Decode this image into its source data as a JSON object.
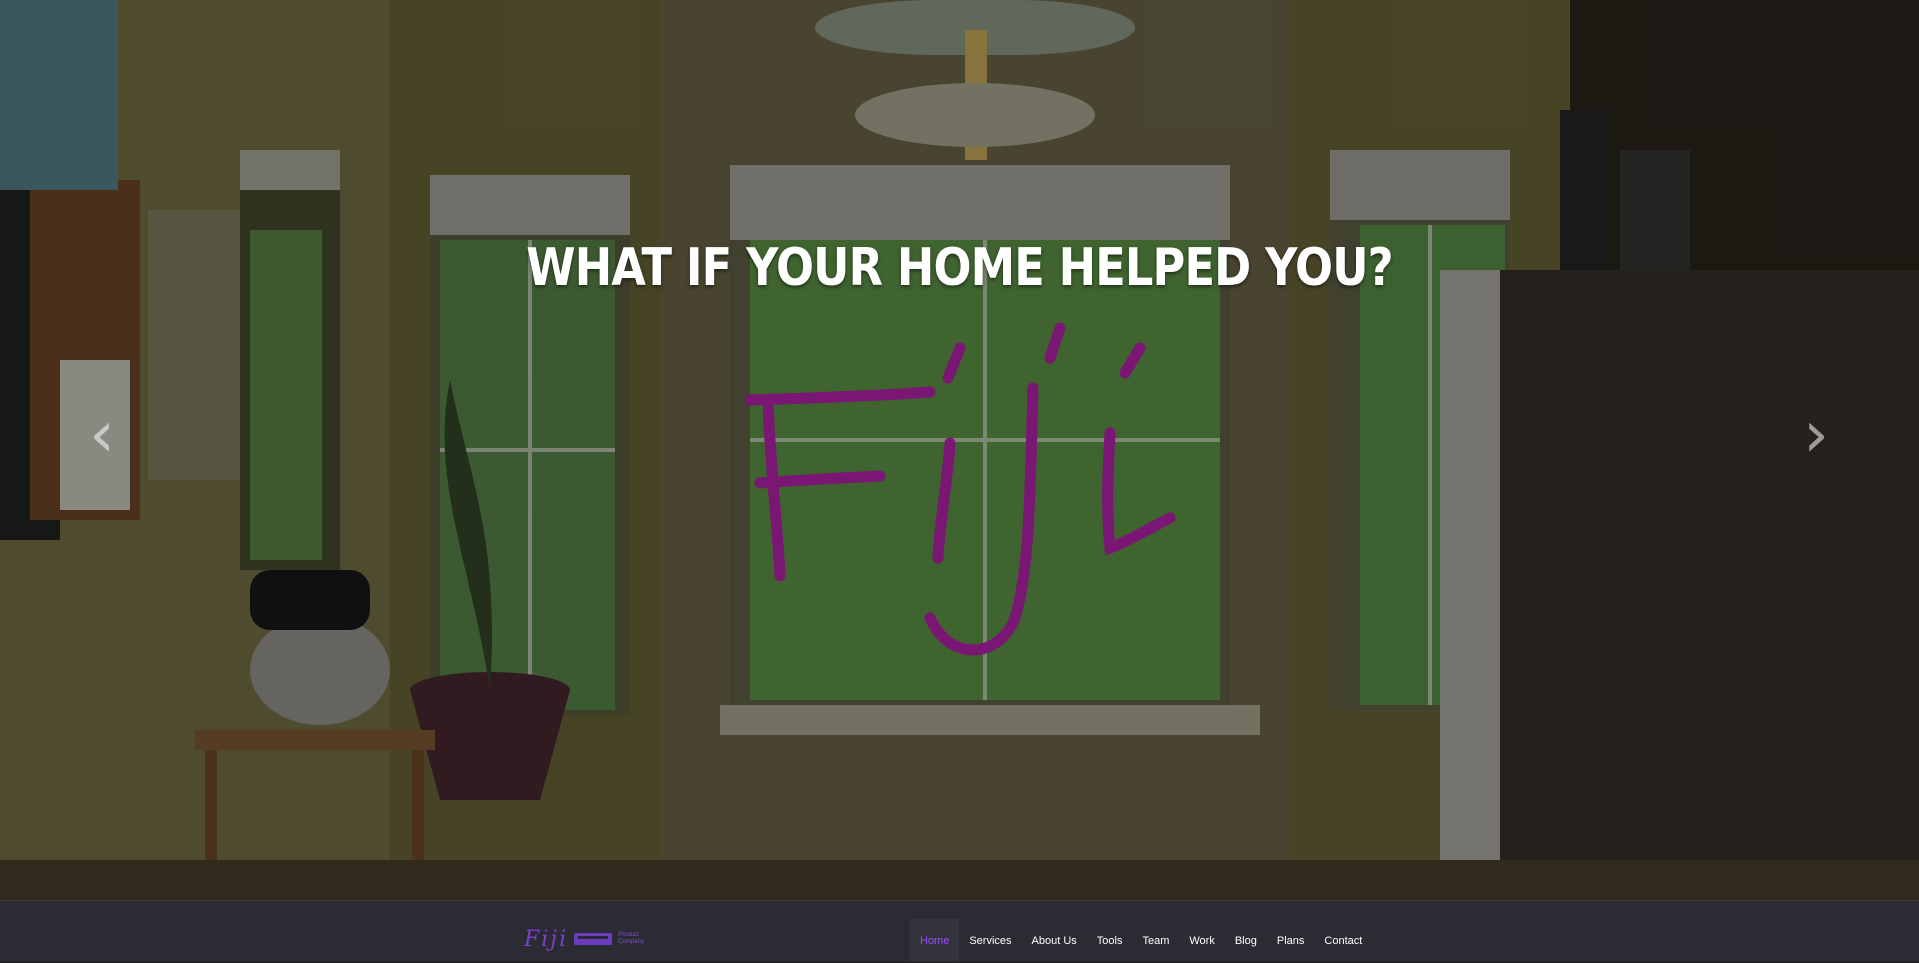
{
  "hero": {
    "headline": "WHAT IF YOUR HOME HELPED YOU?",
    "logo_text": "Fiji",
    "prev_arrow": "‹",
    "next_arrow": "›"
  },
  "brand": {
    "name": "Fiji",
    "tagline_line1": "Product",
    "tagline_line2": "Company"
  },
  "nav": {
    "items": [
      {
        "label": "Home",
        "active": true
      },
      {
        "label": "Services"
      },
      {
        "label": "About Us"
      },
      {
        "label": "Tools"
      },
      {
        "label": "Team"
      },
      {
        "label": "Work"
      },
      {
        "label": "Blog"
      },
      {
        "label": "Plans"
      },
      {
        "label": "Contact"
      }
    ]
  },
  "colors": {
    "accent": "#9b4dff",
    "logo_script": "#7a1673",
    "navbar_bg": "#2b2b33"
  }
}
